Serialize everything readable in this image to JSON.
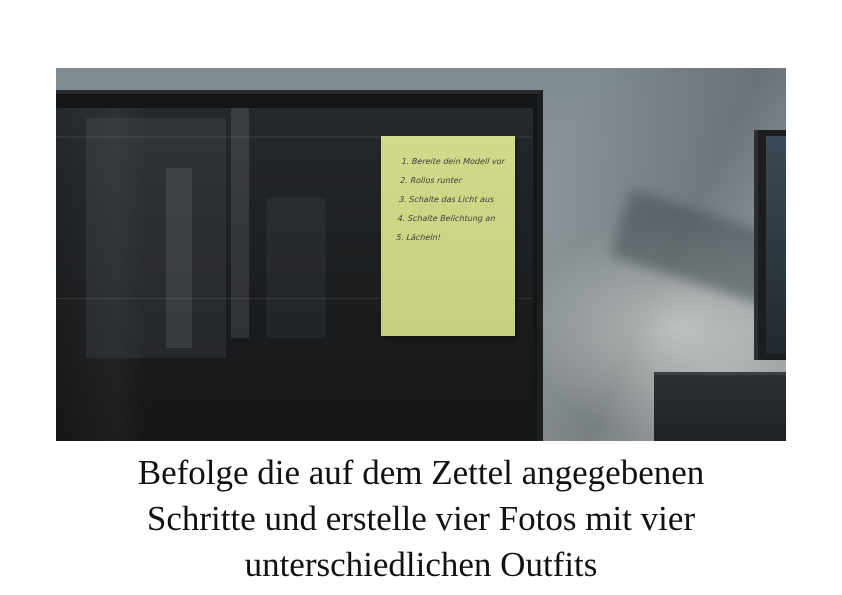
{
  "note": {
    "items": [
      "1. Bereite dein Modell vor",
      "2. Rollos runter",
      "3. Schalte das Licht aus",
      "4. Schalte Belichtung an",
      "5. Lächeln!"
    ]
  },
  "caption": {
    "line1": "Befolge die auf dem Zettel angegebenen",
    "line2": "Schritte und erstelle vier Fotos mit vier",
    "line3": "unterschiedlichen Outfits"
  },
  "colors": {
    "note": "#cdd484",
    "monitor": "#141618",
    "wall": "#8e979b"
  }
}
